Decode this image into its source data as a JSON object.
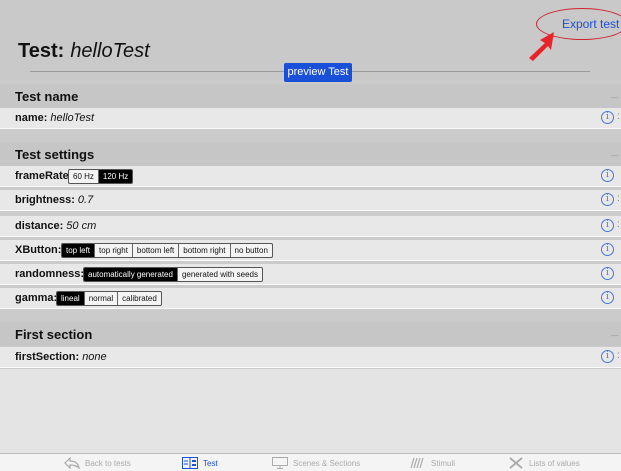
{
  "header": {
    "title_label": "Test:",
    "title_name": "helloTest",
    "preview_label": "preview Test",
    "export_label": "Export test >"
  },
  "sections": {
    "test_name": "Test name",
    "test_settings": "Test settings",
    "first_section": "First section",
    "collapse_marker": "—"
  },
  "rows": {
    "name": {
      "label": "name:",
      "value": "helloTest"
    },
    "frameRate": {
      "label": "frameRate:",
      "options": [
        "60 Hz",
        "120 Hz"
      ],
      "selected": "120 Hz"
    },
    "brightness": {
      "label": "brightness:",
      "value": "0.7"
    },
    "distance": {
      "label": "distance:",
      "value": "50 cm"
    },
    "xbutton": {
      "label": "XButton:",
      "options": [
        "top left",
        "top right",
        "bottom left",
        "bottom right",
        "no button"
      ],
      "selected": "top left"
    },
    "randomness": {
      "label": "randomness:",
      "options": [
        "automatically generated",
        "generated with seeds"
      ],
      "selected": "automatically generated"
    },
    "gamma": {
      "label": "gamma:",
      "options": [
        "lineal",
        "normal",
        "calibrated"
      ],
      "selected": "lineal"
    },
    "firstSection": {
      "label": "firstSection:",
      "value": "none"
    }
  },
  "info_glyph": "i",
  "edge_glyph": ":",
  "tabs": [
    {
      "label": "Back to tests",
      "icon": "back-arrow-icon"
    },
    {
      "label": "Test",
      "icon": "test-grid-icon"
    },
    {
      "label": "Scenes & Sections",
      "icon": "monitor-icon"
    },
    {
      "label": "Stimuli",
      "icon": "stimuli-waves-icon"
    },
    {
      "label": "Lists of values",
      "icon": "lists-x-icon"
    }
  ],
  "colors": {
    "accent": "#1a4fd8",
    "annotation": "#d0242f",
    "selected_segment": "#000000"
  }
}
